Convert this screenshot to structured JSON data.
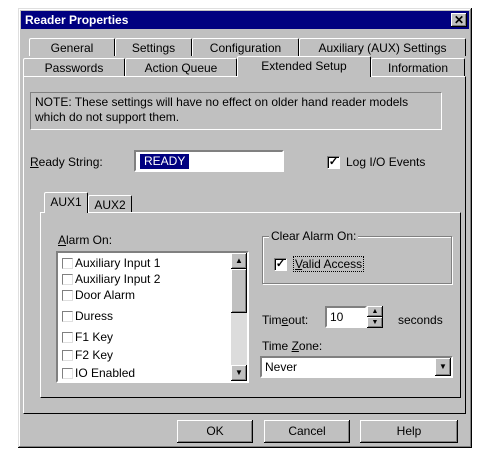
{
  "window": {
    "title": "Reader Properties",
    "close_glyph": "✕"
  },
  "tabs_row1": [
    "General",
    "Settings",
    "Configuration",
    "Auxiliary (AUX) Settings"
  ],
  "tabs_row2": [
    "Passwords",
    "Action Queue",
    "Extended Setup",
    "Information"
  ],
  "active_tab": "Extended Setup",
  "note": "NOTE: These settings will have no effect on older hand reader models which do not support them.",
  "ready_string": {
    "label_prefix": "R",
    "label_rest": "eady String:",
    "value": "READY"
  },
  "log_io": {
    "label": "Log I/O Events",
    "checked": true
  },
  "aux_tabs": [
    "AUX1",
    "AUX2"
  ],
  "alarm_on": {
    "label_prefix": "A",
    "label_rest": "larm On:",
    "items": [
      "Auxiliary Input 1",
      "Auxiliary Input 2",
      "Door Alarm",
      "Duress",
      "F1 Key",
      "F2 Key",
      "IO Enabled"
    ]
  },
  "clear_alarm": {
    "label": "Clear Alarm On:",
    "valid_access_prefix": "V",
    "valid_access_rest": "alid Access",
    "checked": true
  },
  "timeout": {
    "label_pre": "Tim",
    "label_u": "e",
    "label_post": "out:",
    "value": "10",
    "unit": "seconds"
  },
  "time_zone": {
    "label_pre": "Time ",
    "label_u": "Z",
    "label_post": "one:",
    "value": "Never"
  },
  "buttons": {
    "ok": "OK",
    "cancel": "Cancel",
    "help": "Help"
  },
  "colors": {
    "titlebar": "#000080",
    "face": "#c0c0c0",
    "highlight_text": "#000080"
  }
}
